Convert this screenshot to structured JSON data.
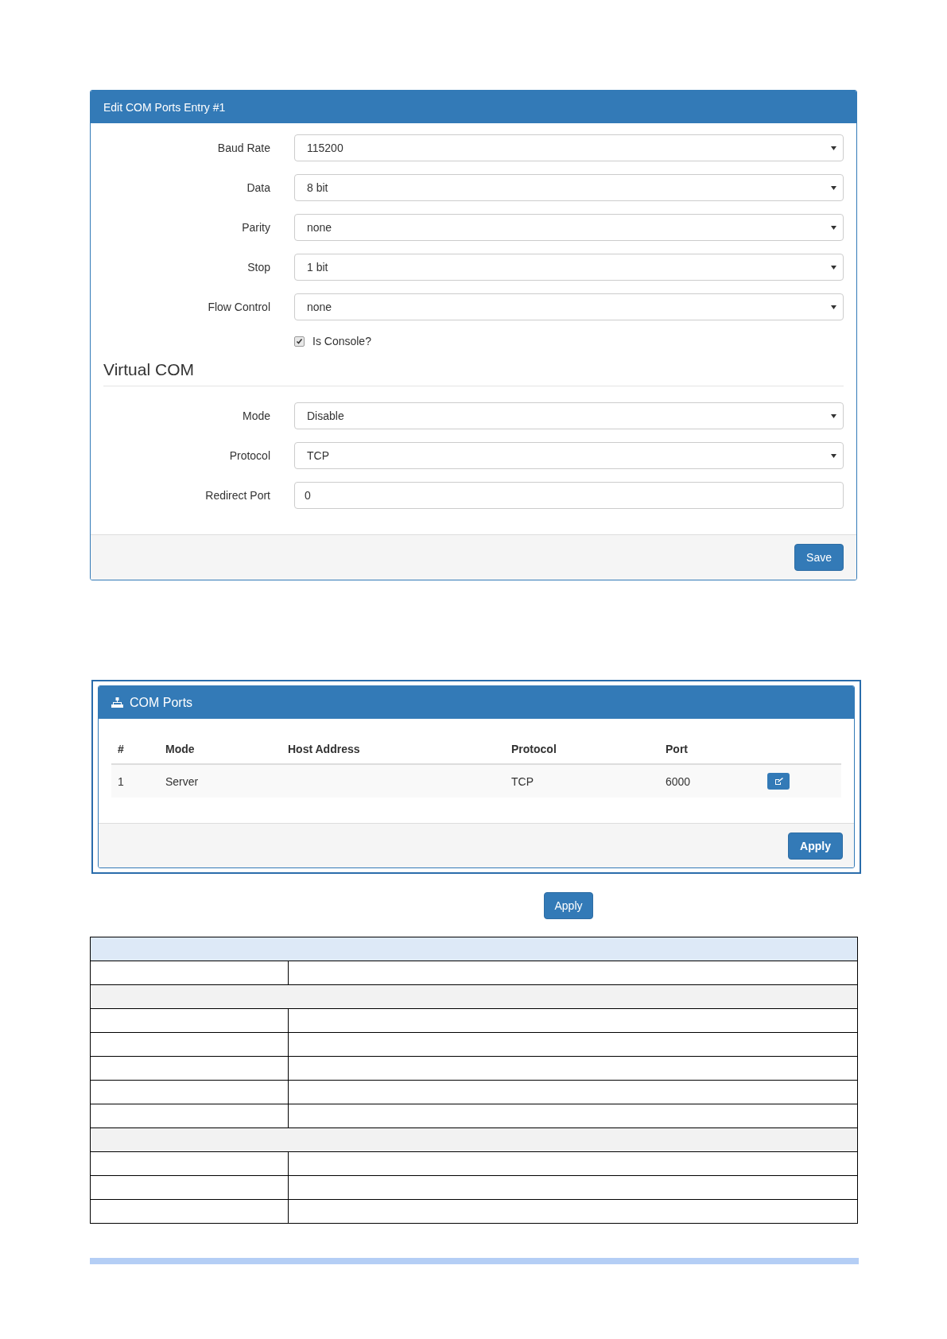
{
  "edit_panel": {
    "title": "Edit COM Ports Entry #1",
    "fields": [
      {
        "label": "Baud Rate",
        "kind": "select",
        "value": "115200"
      },
      {
        "label": "Data",
        "kind": "select",
        "value": "8 bit"
      },
      {
        "label": "Parity",
        "kind": "select",
        "value": "none"
      },
      {
        "label": "Stop",
        "kind": "select",
        "value": "1 bit"
      },
      {
        "label": "Flow Control",
        "kind": "select",
        "value": "none"
      }
    ],
    "console_checkbox": {
      "label": "Is Console?",
      "checked": true
    },
    "section_title": "Virtual COM",
    "virtual_fields": [
      {
        "label": "Mode",
        "kind": "select",
        "value": "Disable"
      },
      {
        "label": "Protocol",
        "kind": "select",
        "value": "TCP"
      },
      {
        "label": "Redirect Port",
        "kind": "text",
        "value": "0"
      }
    ],
    "save_button": "Save"
  },
  "com_ports_panel": {
    "title": "COM Ports",
    "table": {
      "columns": [
        "#",
        "Mode",
        "Host Address",
        "Protocol",
        "Port"
      ],
      "rows": [
        [
          "1",
          "Server",
          "",
          "TCP",
          "6000"
        ]
      ]
    },
    "apply_button": "Apply"
  },
  "apply_button": "Apply",
  "doc_table": {
    "rows": [
      {
        "kind": "header"
      },
      {
        "kind": "pair"
      },
      {
        "kind": "section"
      },
      {
        "kind": "pair"
      },
      {
        "kind": "pair"
      },
      {
        "kind": "pair"
      },
      {
        "kind": "pair"
      },
      {
        "kind": "pair"
      },
      {
        "kind": "section"
      },
      {
        "kind": "pair"
      },
      {
        "kind": "pair"
      },
      {
        "kind": "pair"
      }
    ]
  }
}
